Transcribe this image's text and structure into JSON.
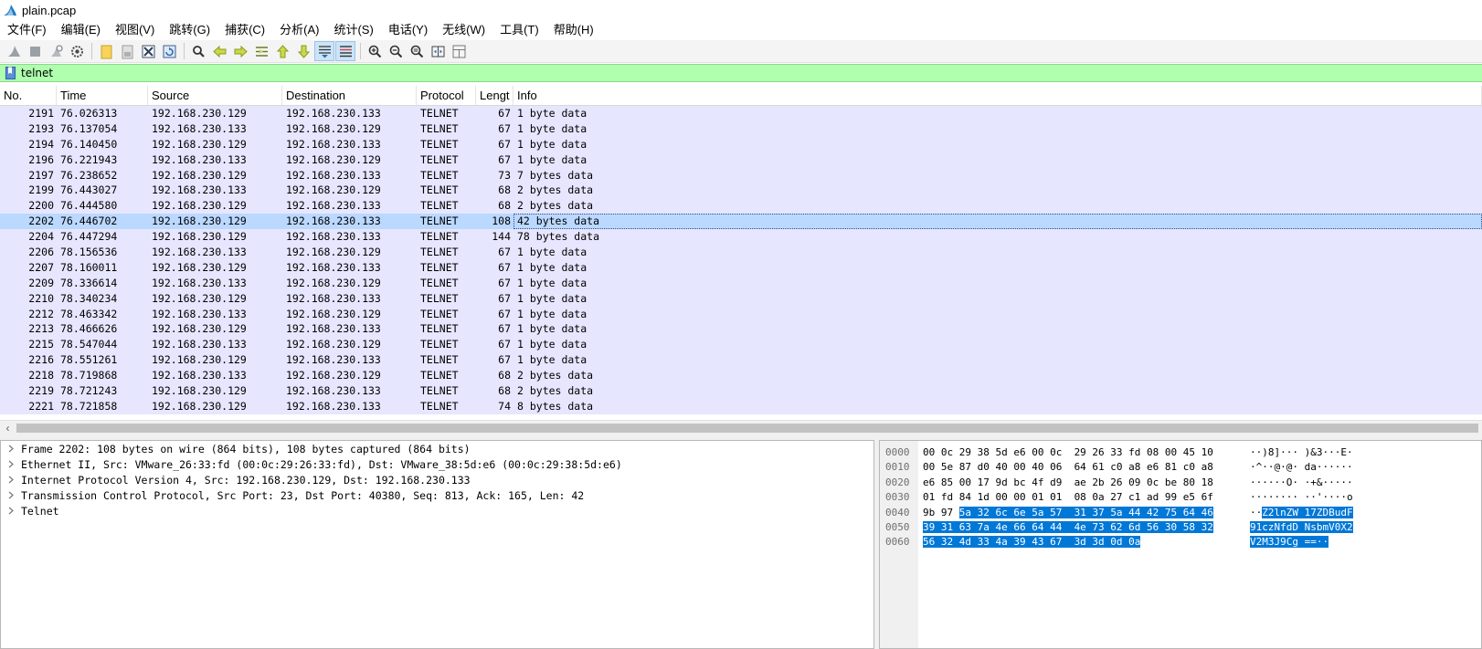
{
  "window": {
    "title": "plain.pcap"
  },
  "menu": [
    "文件(F)",
    "编辑(E)",
    "视图(V)",
    "跳转(G)",
    "捕获(C)",
    "分析(A)",
    "统计(S)",
    "电话(Y)",
    "无线(W)",
    "工具(T)",
    "帮助(H)"
  ],
  "toolbar": [
    {
      "icon": "shark-fin-start-icon"
    },
    {
      "icon": "stop-square-icon"
    },
    {
      "icon": "restart-shark-icon"
    },
    {
      "icon": "gear-options-icon"
    },
    {
      "sep": true
    },
    {
      "icon": "open-folder-icon"
    },
    {
      "icon": "save-file-icon"
    },
    {
      "icon": "close-file-icon"
    },
    {
      "icon": "reload-icon"
    },
    {
      "sep": true
    },
    {
      "icon": "find-packet-icon"
    },
    {
      "icon": "go-back-icon"
    },
    {
      "icon": "go-forward-icon"
    },
    {
      "icon": "go-to-packet-icon"
    },
    {
      "icon": "go-first-icon"
    },
    {
      "icon": "go-last-icon"
    },
    {
      "icon": "autoscroll-icon",
      "active": true
    },
    {
      "icon": "colorize-icon",
      "active": true
    },
    {
      "sep": true
    },
    {
      "icon": "zoom-in-icon"
    },
    {
      "icon": "zoom-out-icon"
    },
    {
      "icon": "zoom-normal-icon"
    },
    {
      "icon": "resize-columns-icon"
    },
    {
      "icon": "layout-icon"
    }
  ],
  "filter": {
    "value": "telnet"
  },
  "packet_list": {
    "columns": [
      "No.",
      "Time",
      "Source",
      "Destination",
      "Protocol",
      "Lengt",
      "Info"
    ],
    "rows": [
      {
        "no": "2191",
        "time": "76.026313",
        "src": "192.168.230.129",
        "dst": "192.168.230.133",
        "proto": "TELNET",
        "len": "67",
        "info": "1 byte data"
      },
      {
        "no": "2193",
        "time": "76.137054",
        "src": "192.168.230.133",
        "dst": "192.168.230.129",
        "proto": "TELNET",
        "len": "67",
        "info": "1 byte data"
      },
      {
        "no": "2194",
        "time": "76.140450",
        "src": "192.168.230.129",
        "dst": "192.168.230.133",
        "proto": "TELNET",
        "len": "67",
        "info": "1 byte data"
      },
      {
        "no": "2196",
        "time": "76.221943",
        "src": "192.168.230.133",
        "dst": "192.168.230.129",
        "proto": "TELNET",
        "len": "67",
        "info": "1 byte data"
      },
      {
        "no": "2197",
        "time": "76.238652",
        "src": "192.168.230.129",
        "dst": "192.168.230.133",
        "proto": "TELNET",
        "len": "73",
        "info": "7 bytes data"
      },
      {
        "no": "2199",
        "time": "76.443027",
        "src": "192.168.230.133",
        "dst": "192.168.230.129",
        "proto": "TELNET",
        "len": "68",
        "info": "2 bytes data"
      },
      {
        "no": "2200",
        "time": "76.444580",
        "src": "192.168.230.129",
        "dst": "192.168.230.133",
        "proto": "TELNET",
        "len": "68",
        "info": "2 bytes data"
      },
      {
        "no": "2202",
        "time": "76.446702",
        "src": "192.168.230.129",
        "dst": "192.168.230.133",
        "proto": "TELNET",
        "len": "108",
        "info": "42 bytes data",
        "selected": true
      },
      {
        "no": "2204",
        "time": "76.447294",
        "src": "192.168.230.129",
        "dst": "192.168.230.133",
        "proto": "TELNET",
        "len": "144",
        "info": "78 bytes data"
      },
      {
        "no": "2206",
        "time": "78.156536",
        "src": "192.168.230.133",
        "dst": "192.168.230.129",
        "proto": "TELNET",
        "len": "67",
        "info": "1 byte data"
      },
      {
        "no": "2207",
        "time": "78.160011",
        "src": "192.168.230.129",
        "dst": "192.168.230.133",
        "proto": "TELNET",
        "len": "67",
        "info": "1 byte data"
      },
      {
        "no": "2209",
        "time": "78.336614",
        "src": "192.168.230.133",
        "dst": "192.168.230.129",
        "proto": "TELNET",
        "len": "67",
        "info": "1 byte data"
      },
      {
        "no": "2210",
        "time": "78.340234",
        "src": "192.168.230.129",
        "dst": "192.168.230.133",
        "proto": "TELNET",
        "len": "67",
        "info": "1 byte data"
      },
      {
        "no": "2212",
        "time": "78.463342",
        "src": "192.168.230.133",
        "dst": "192.168.230.129",
        "proto": "TELNET",
        "len": "67",
        "info": "1 byte data"
      },
      {
        "no": "2213",
        "time": "78.466626",
        "src": "192.168.230.129",
        "dst": "192.168.230.133",
        "proto": "TELNET",
        "len": "67",
        "info": "1 byte data"
      },
      {
        "no": "2215",
        "time": "78.547044",
        "src": "192.168.230.133",
        "dst": "192.168.230.129",
        "proto": "TELNET",
        "len": "67",
        "info": "1 byte data"
      },
      {
        "no": "2216",
        "time": "78.551261",
        "src": "192.168.230.129",
        "dst": "192.168.230.133",
        "proto": "TELNET",
        "len": "67",
        "info": "1 byte data"
      },
      {
        "no": "2218",
        "time": "78.719868",
        "src": "192.168.230.133",
        "dst": "192.168.230.129",
        "proto": "TELNET",
        "len": "68",
        "info": "2 bytes data"
      },
      {
        "no": "2219",
        "time": "78.721243",
        "src": "192.168.230.129",
        "dst": "192.168.230.133",
        "proto": "TELNET",
        "len": "68",
        "info": "2 bytes data"
      },
      {
        "no": "2221",
        "time": "78.721858",
        "src": "192.168.230.129",
        "dst": "192.168.230.133",
        "proto": "TELNET",
        "len": "74",
        "info": "8 bytes data"
      }
    ]
  },
  "details": [
    "Frame 2202: 108 bytes on wire (864 bits), 108 bytes captured (864 bits)",
    "Ethernet II, Src: VMware_26:33:fd (00:0c:29:26:33:fd), Dst: VMware_38:5d:e6 (00:0c:29:38:5d:e6)",
    "Internet Protocol Version 4, Src: 192.168.230.129, Dst: 192.168.230.133",
    "Transmission Control Protocol, Src Port: 23, Dst Port: 40380, Seq: 813, Ack: 165, Len: 42",
    "Telnet"
  ],
  "bytes": [
    {
      "offset": "0000",
      "hex": "00 0c 29 38 5d e6 00 0c  29 26 33 fd 08 00 45 10",
      "ascii": "··)8]··· )&3···E·"
    },
    {
      "offset": "0010",
      "hex": "00 5e 87 d0 40 00 40 06  64 61 c0 a8 e6 81 c0 a8",
      "ascii": "·^··@·@· da······"
    },
    {
      "offset": "0020",
      "hex": "e6 85 00 17 9d bc 4f d9  ae 2b 26 09 0c be 80 18",
      "ascii": "······O· ·+&·····"
    },
    {
      "offset": "0030",
      "hex": "01 fd 84 1d 00 00 01 01  08 0a 27 c1 ad 99 e5 6f",
      "ascii": "········ ··'····o"
    },
    {
      "offset": "0040",
      "hex_plain": "9b 97 ",
      "hex_hl": "5a 32 6c 6e 5a 57  31 37 5a 44 42 75 64 46",
      "ascii_plain": "··",
      "ascii_hl": "Z2lnZW 17ZDBudF"
    },
    {
      "offset": "0050",
      "hex_hl": "39 31 63 7a 4e 66 64 44  4e 73 62 6d 56 30 58 32",
      "ascii_hl": "91czNfdD NsbmV0X2"
    },
    {
      "offset": "0060",
      "hex_hl": "56 32 4d 33 4a 39 43 67  3d 3d 0d 0a",
      "ascii_hl": "V2M3J9Cg ==··"
    }
  ],
  "colors": {
    "filter_bg": "#afffaf",
    "row_bg": "#e7e6ff",
    "row_selected": "#bbd8ff",
    "bytes_highlight": "#0078d7"
  }
}
